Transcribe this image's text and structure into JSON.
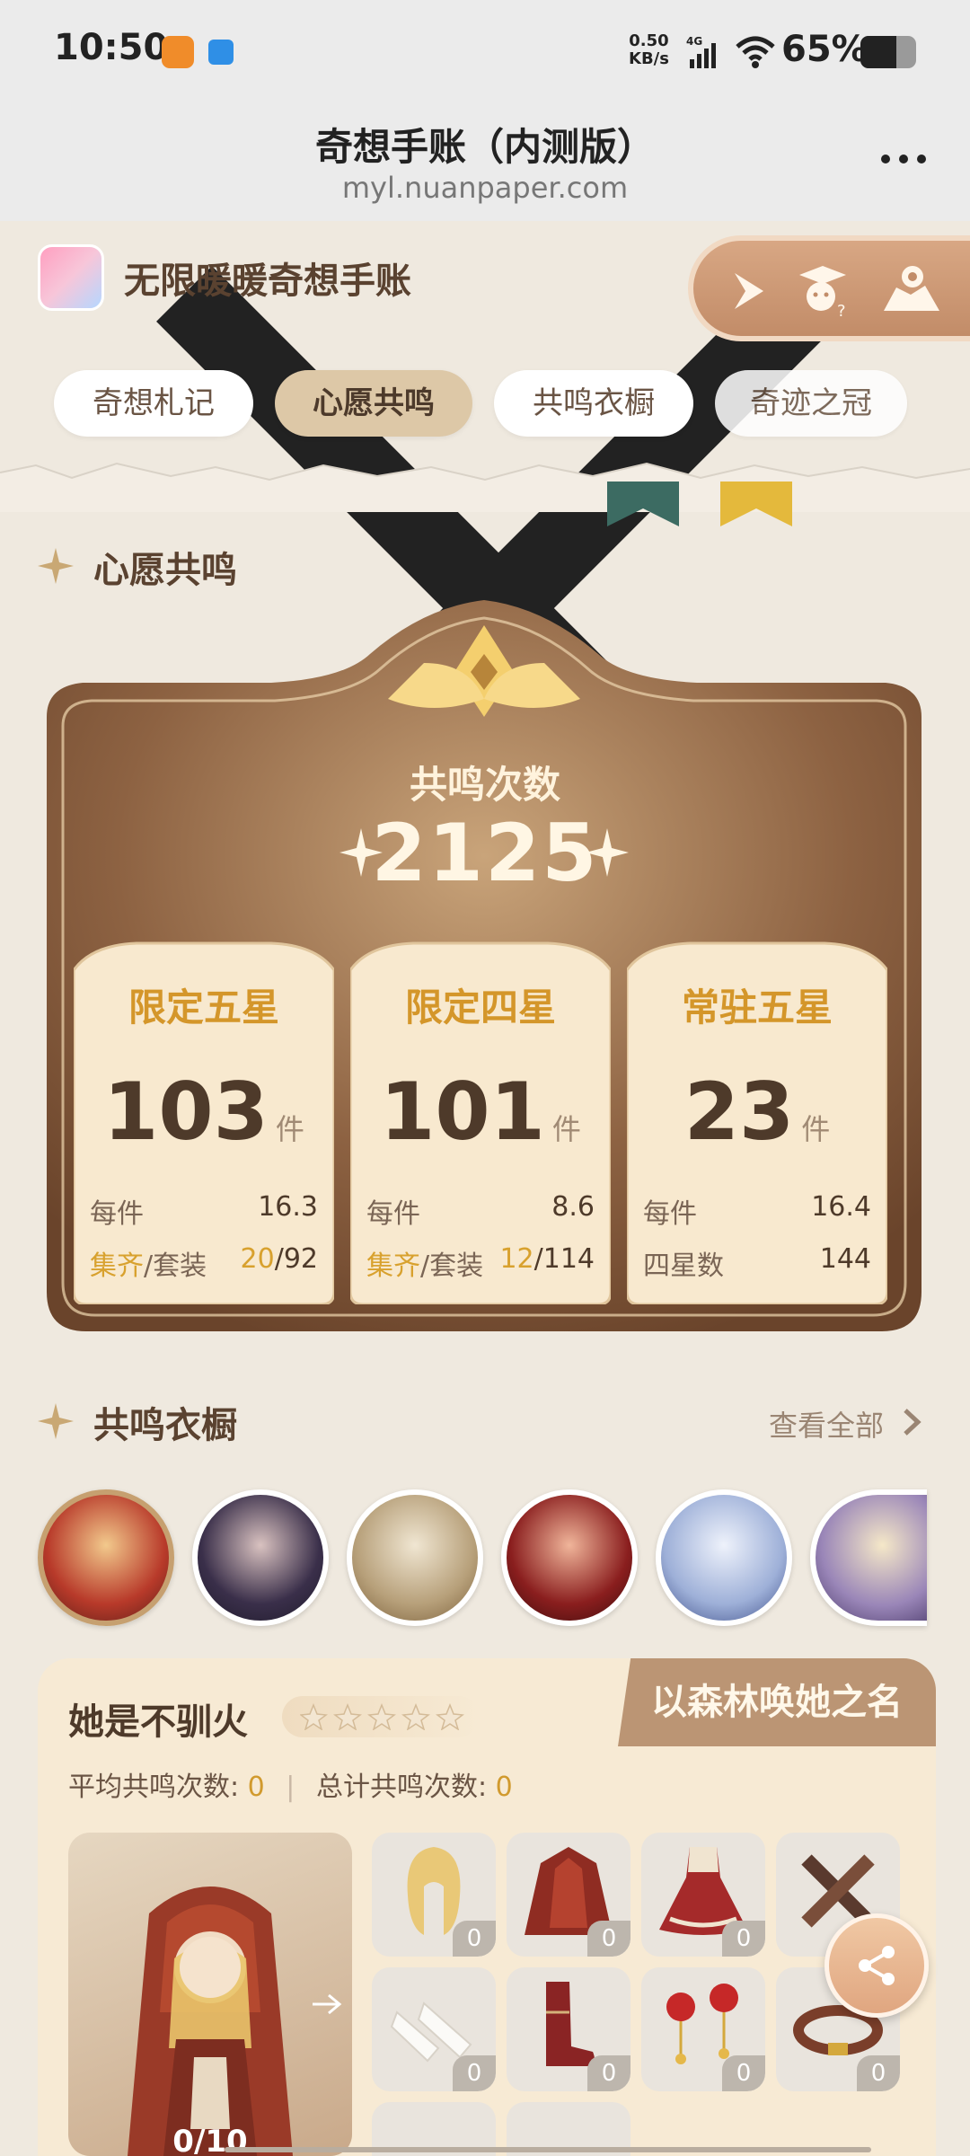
{
  "status": {
    "time": "10:50",
    "net_speed_top": "0.50",
    "net_speed_bottom": "KB/s",
    "net_type": "4G",
    "battery": "65%",
    "battery_level": 0.65
  },
  "titlebar": {
    "title": "奇想手账（内测版）",
    "url": "myl.nuanpaper.com"
  },
  "header": {
    "app_name": "无限暖暖奇想手账"
  },
  "tabs": [
    {
      "label": "奇想札记"
    },
    {
      "label": "心愿共鸣",
      "active": true
    },
    {
      "label": "共鸣衣橱"
    },
    {
      "label": "奇迹之冠"
    }
  ],
  "resonance": {
    "section_title": "心愿共鸣",
    "total_label": "共鸣次数",
    "total_value": "2125",
    "panels": [
      {
        "title": "限定五星",
        "count": "103",
        "unit": "件",
        "row1_label": "每件",
        "row1_value": "16.3",
        "row2_label_a": "集齐",
        "row2_label_b": "/套装",
        "row2_value_a": "20",
        "row2_value_b": "/92"
      },
      {
        "title": "限定四星",
        "count": "101",
        "unit": "件",
        "row1_label": "每件",
        "row1_value": "8.6",
        "row2_label_a": "集齐",
        "row2_label_b": "/套装",
        "row2_value_a": "12",
        "row2_value_b": "/114"
      },
      {
        "title": "常驻五星",
        "count": "23",
        "unit": "件",
        "row1_label": "每件",
        "row1_value": "16.4",
        "row2_label": "四星数",
        "row2_value": "144"
      }
    ]
  },
  "wardrobe": {
    "section_title": "共鸣衣橱",
    "see_all": "查看全部",
    "outfit": {
      "name": "她是不驯火",
      "set_name": "以森林唤她之名",
      "avg_label": "平均共鸣次数:",
      "avg_value": "0",
      "total_label": "总计共鸣次数:",
      "total_value": "0",
      "progress": "0/10",
      "item_counts": [
        "0",
        "0",
        "0",
        "0",
        "0",
        "0",
        "0",
        "0"
      ]
    }
  },
  "colors": {
    "accent": "#c6a070",
    "gold": "#d8a12e",
    "card_dark": "#7a4f33"
  }
}
